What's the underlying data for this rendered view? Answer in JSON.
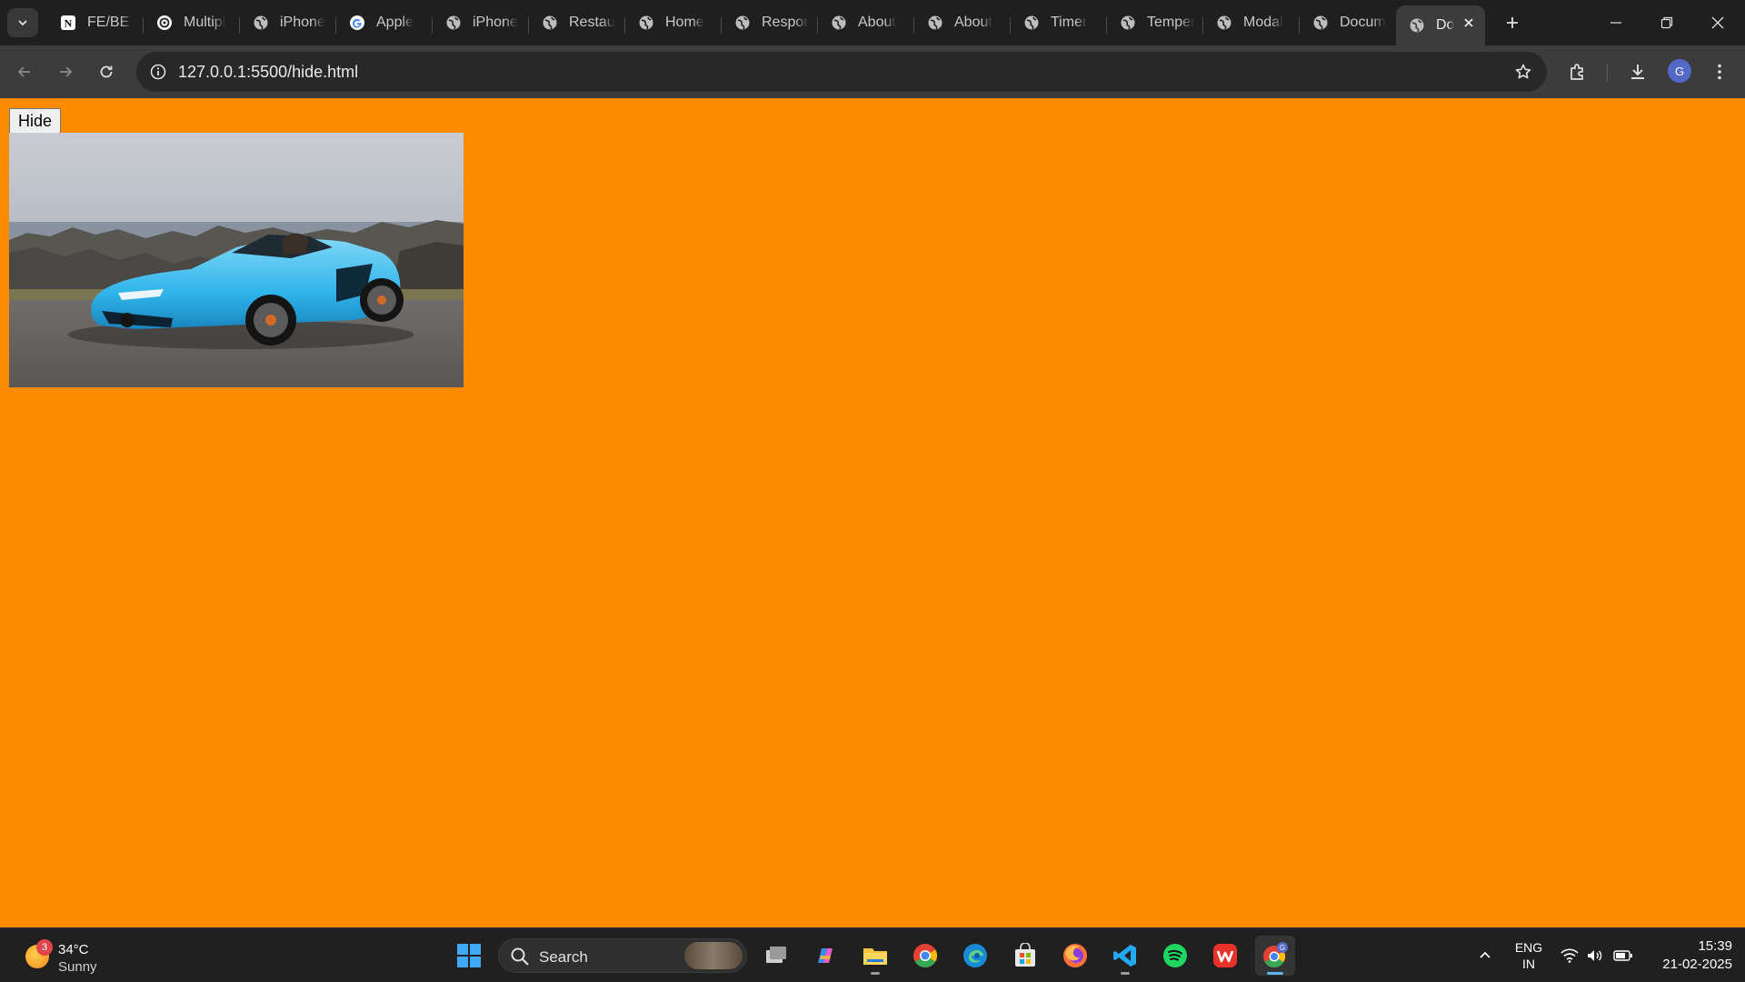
{
  "tabs": [
    {
      "title": "FE/BE D",
      "icon": "notion-icon"
    },
    {
      "title": "Multipl",
      "icon": "openai-icon"
    },
    {
      "title": "iPhone",
      "icon": "globe-icon"
    },
    {
      "title": "Apple",
      "icon": "google-icon"
    },
    {
      "title": "iPhone",
      "icon": "globe-icon"
    },
    {
      "title": "Restau",
      "icon": "globe-icon"
    },
    {
      "title": "Home",
      "icon": "globe-icon"
    },
    {
      "title": "Respon",
      "icon": "globe-icon"
    },
    {
      "title": "About",
      "icon": "globe-icon"
    },
    {
      "title": "About",
      "icon": "globe-icon"
    },
    {
      "title": "Timer",
      "icon": "globe-icon"
    },
    {
      "title": "Temper",
      "icon": "globe-icon"
    },
    {
      "title": "Modal",
      "icon": "globe-icon"
    },
    {
      "title": "Docum",
      "icon": "globe-icon"
    },
    {
      "title": "Do",
      "icon": "globe-icon",
      "active": true
    }
  ],
  "toolbar": {
    "url": "127.0.0.1:5500/hide.html",
    "profile_initial": "G"
  },
  "page": {
    "background": "#ff8c00",
    "hide_button_label": "Hide",
    "image_subject": "light blue convertible sports car parked by a rocky coastline"
  },
  "taskbar": {
    "weather_temp": "34°C",
    "weather_condition": "Sunny",
    "weather_badge": "3",
    "search_label": "Search",
    "apps": [
      "windows-start-icon",
      "task-view-icon",
      "copilot-icon",
      "file-explorer-icon",
      "chrome-icon",
      "edge-icon",
      "microsoft-store-icon",
      "firefox-icon",
      "vscode-icon",
      "spotify-icon",
      "wps-office-icon",
      "chrome-profile-icon"
    ],
    "lang_line1": "ENG",
    "lang_line2": "IN",
    "time": "15:39",
    "date": "21-02-2025"
  },
  "colors": {
    "page_background": "#ff8c00",
    "tab_strip": "#1f1f1f",
    "toolbar": "#3c3c3c",
    "taskbar": "#202020"
  }
}
